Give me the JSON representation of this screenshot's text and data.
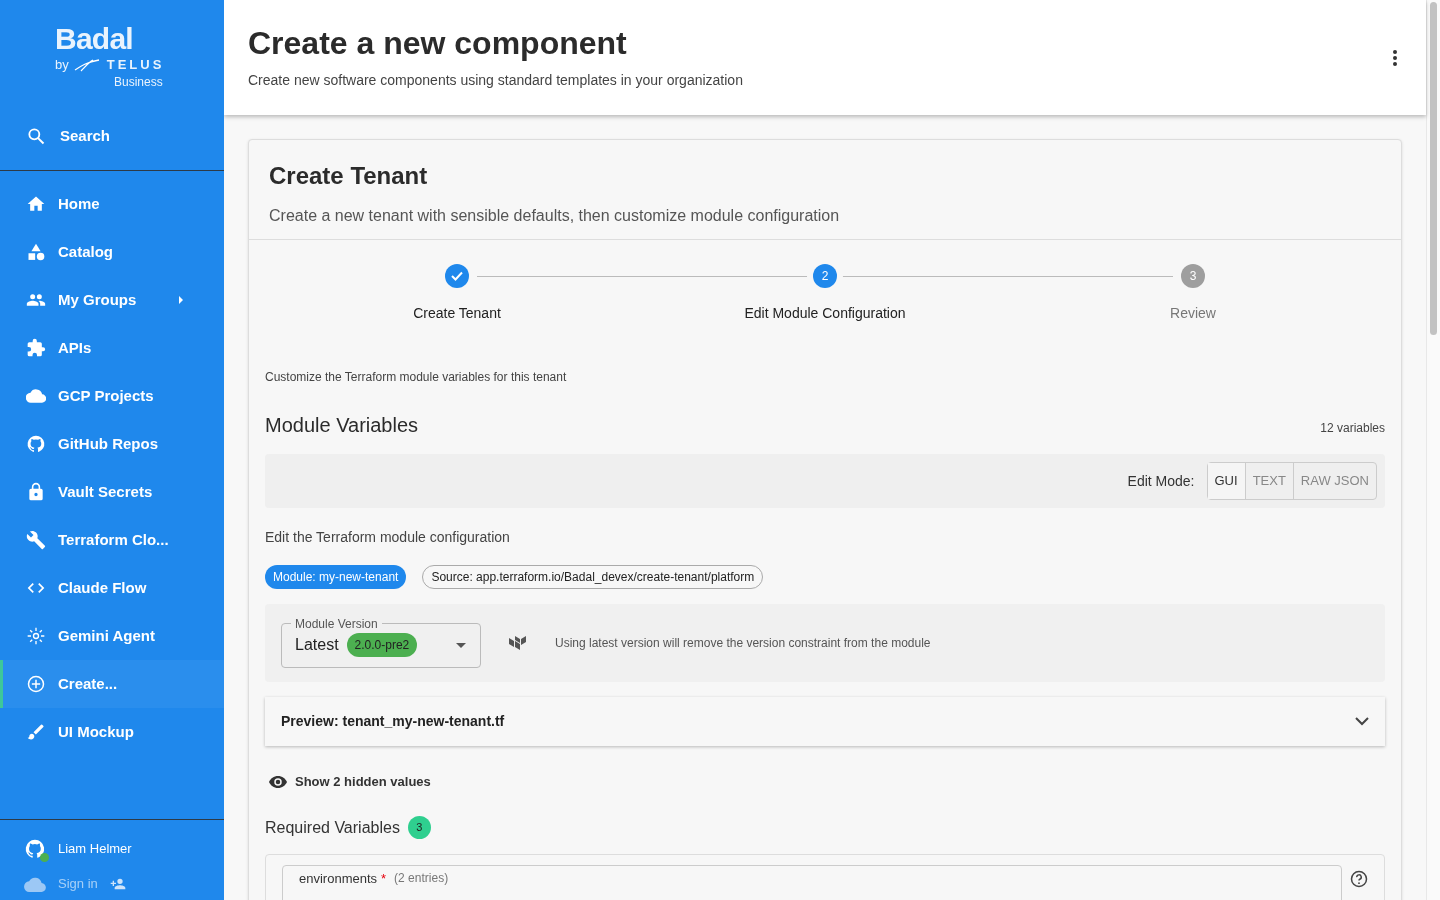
{
  "sidebar": {
    "logo": {
      "title": "Badal",
      "by": "by",
      "brand": "TELUS",
      "sub": "Business"
    },
    "search": "Search",
    "items": [
      {
        "label": "Home",
        "expandable": false,
        "selected": false
      },
      {
        "label": "Catalog",
        "expandable": false,
        "selected": false
      },
      {
        "label": "My Groups",
        "expandable": true,
        "selected": false
      },
      {
        "label": "APIs",
        "expandable": false,
        "selected": false
      },
      {
        "label": "GCP Projects",
        "expandable": false,
        "selected": false
      },
      {
        "label": "GitHub Repos",
        "expandable": false,
        "selected": false
      },
      {
        "label": "Vault Secrets",
        "expandable": false,
        "selected": false
      },
      {
        "label": "Terraform Clo...",
        "expandable": false,
        "selected": false
      },
      {
        "label": "Claude Flow",
        "expandable": false,
        "selected": false
      },
      {
        "label": "Gemini Agent",
        "expandable": false,
        "selected": false
      },
      {
        "label": "Create...",
        "expandable": false,
        "selected": true
      },
      {
        "label": "UI Mockup",
        "expandable": false,
        "selected": false
      }
    ],
    "user": {
      "name": "Liam Helmer",
      "online": true
    },
    "sign_in": "Sign in"
  },
  "header": {
    "title": "Create a new component",
    "subtitle": "Create new software components using standard templates in your organization"
  },
  "card": {
    "title": "Create Tenant",
    "subtitle": "Create a new tenant with sensible defaults, then customize module configuration",
    "steps": [
      {
        "label": "Create Tenant",
        "completed": true,
        "active": false
      },
      {
        "number": "2",
        "label": "Edit Module Configuration",
        "completed": false,
        "active": true
      },
      {
        "number": "3",
        "label": "Review",
        "completed": false,
        "active": false
      }
    ],
    "hint": "Customize the Terraform module variables for this tenant",
    "section_title": "Module Variables",
    "count": "12 variables",
    "edit_mode": {
      "label": "Edit Mode:",
      "options": [
        {
          "label": "GUI",
          "selected": true
        },
        {
          "label": "TEXT",
          "selected": false
        },
        {
          "label": "RAW JSON",
          "selected": false
        }
      ]
    },
    "edit_caption": "Edit the Terraform module configuration",
    "chips": [
      {
        "label": "Module: my-new-tenant",
        "kind": "filled"
      },
      {
        "label": "Source: app.terraform.io/Badal_devex/create-tenant/platform",
        "kind": "outlined"
      }
    ],
    "version": {
      "label": "Module Version",
      "value": "Latest",
      "badge": "2.0.0-pre2",
      "note": "Using latest version will remove the version constraint from the module"
    },
    "preview": {
      "title": "Preview: tenant_my-new-tenant.tf",
      "expanded": false
    },
    "hidden_toggle": "Show 2 hidden values",
    "required": {
      "title": "Required Variables",
      "count": "3",
      "field": {
        "name": "environments",
        "required_mark": "*",
        "meta": "(2 entries)"
      }
    }
  }
}
